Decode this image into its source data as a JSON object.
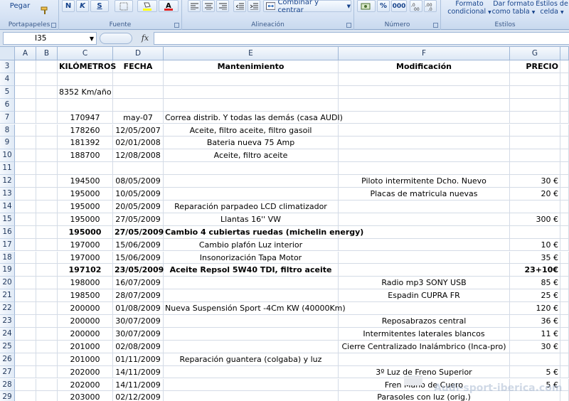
{
  "ribbon": {
    "paste_label": "Pegar",
    "groups": {
      "clipboard": "Portapapeles",
      "font": "Fuente",
      "alignment": "Alineación",
      "number": "Número",
      "styles": "Estilos"
    },
    "font_buttons": {
      "bold": "N",
      "italic": "K",
      "underline": "S"
    },
    "merge_center": "Combinar y centrar",
    "percent": "%",
    "thousands": "000",
    "cond_format": [
      "Formato",
      "condicional"
    ],
    "table_format": [
      "Dar formato",
      "como tabla"
    ],
    "cell_styles": [
      "Estilos de",
      "celda"
    ]
  },
  "formula_bar": {
    "name_box": "I35",
    "fx": "fx"
  },
  "columns": [
    "A",
    "B",
    "C",
    "D",
    "E",
    "F",
    "G"
  ],
  "rows": [
    {
      "n": "3",
      "C": "KILÓMETROS",
      "D": "FECHA",
      "E": "Mantenimiento",
      "F": "Modificación",
      "G": "PRECIO",
      "bold": true
    },
    {
      "n": "4"
    },
    {
      "n": "5",
      "C": "8352 Km/año"
    },
    {
      "n": "6"
    },
    {
      "n": "7",
      "C": "170947",
      "D": "may-07",
      "E": "Correa distrib. Y todas las demás (casa AUDI)"
    },
    {
      "n": "8",
      "C": "178260",
      "D": "12/05/2007",
      "E": "Aceite, filtro aceite, filtro gasoil"
    },
    {
      "n": "9",
      "C": "181392",
      "D": "02/01/2008",
      "E": "Bateria nueva 75 Amp"
    },
    {
      "n": "10",
      "C": "188700",
      "D": "12/08/2008",
      "E": "Aceite, filtro aceite"
    },
    {
      "n": "11"
    },
    {
      "n": "12",
      "C": "194500",
      "D": "08/05/2009",
      "F": "Piloto intermitente Dcho. Nuevo",
      "G": "30 €"
    },
    {
      "n": "13",
      "C": "195000",
      "D": "10/05/2009",
      "F": "Placas de matricula nuevas",
      "G": "20 €"
    },
    {
      "n": "14",
      "C": "195000",
      "D": "20/05/2009",
      "E": "Reparación parpadeo LCD climatizador"
    },
    {
      "n": "15",
      "C": "195000",
      "D": "27/05/2009",
      "E": "Llantas 16'' VW",
      "G": "300 €"
    },
    {
      "n": "16",
      "C": "195000",
      "D": "27/05/2009",
      "E": "Cambio 4 cubiertas ruedas (michelin energy)",
      "bold": true
    },
    {
      "n": "17",
      "C": "197000",
      "D": "15/06/2009",
      "E": "Cambio plafón Luz interior",
      "G": "10 €"
    },
    {
      "n": "18",
      "C": "197000",
      "D": "15/06/2009",
      "E": "Insonorización Tapa Motor",
      "G": "35 €"
    },
    {
      "n": "19",
      "C": "197102",
      "D": "23/05/2009",
      "E": "Aceite Repsol 5W40 TDI, filtro aceite",
      "G": "23+10€",
      "bold": true
    },
    {
      "n": "20",
      "C": "198000",
      "D": "16/07/2009",
      "F": "Radio mp3 SONY USB",
      "G": "85 €"
    },
    {
      "n": "21",
      "C": "198500",
      "D": "28/07/2009",
      "F": "Espadin CUPRA FR",
      "G": "25 €"
    },
    {
      "n": "22",
      "C": "200000",
      "D": "01/08/2009",
      "E": "Nueva Suspensión Sport -4Cm KW (40000Km)",
      "G": "120 €"
    },
    {
      "n": "23",
      "C": "200000",
      "D": "30/07/2009",
      "F": "Reposabrazos central",
      "G": "36 €"
    },
    {
      "n": "24",
      "C": "200000",
      "D": "30/07/2009",
      "F": "Intermitentes laterales blancos",
      "G": "11 €"
    },
    {
      "n": "25",
      "C": "201000",
      "D": "02/08/2009",
      "F": "Cierre Centralizado Inalámbrico (Inca-pro)",
      "G": "30 €"
    },
    {
      "n": "26",
      "C": "201000",
      "D": "01/11/2009",
      "E": "Reparación guantera (colgaba) y luz"
    },
    {
      "n": "27",
      "C": "202000",
      "D": "14/11/2009",
      "F": "3º Luz de Freno Superior",
      "G": "5 €"
    },
    {
      "n": "28",
      "C": "202000",
      "D": "14/11/2009",
      "F": "Fren      Mano de Cuero",
      "G": "5 €"
    },
    {
      "n": "29",
      "C": "203000",
      "D": "02/12/2009",
      "F": "Parasoles con luz (orig.)"
    }
  ],
  "watermark": "Audi-sport-iberica.com"
}
